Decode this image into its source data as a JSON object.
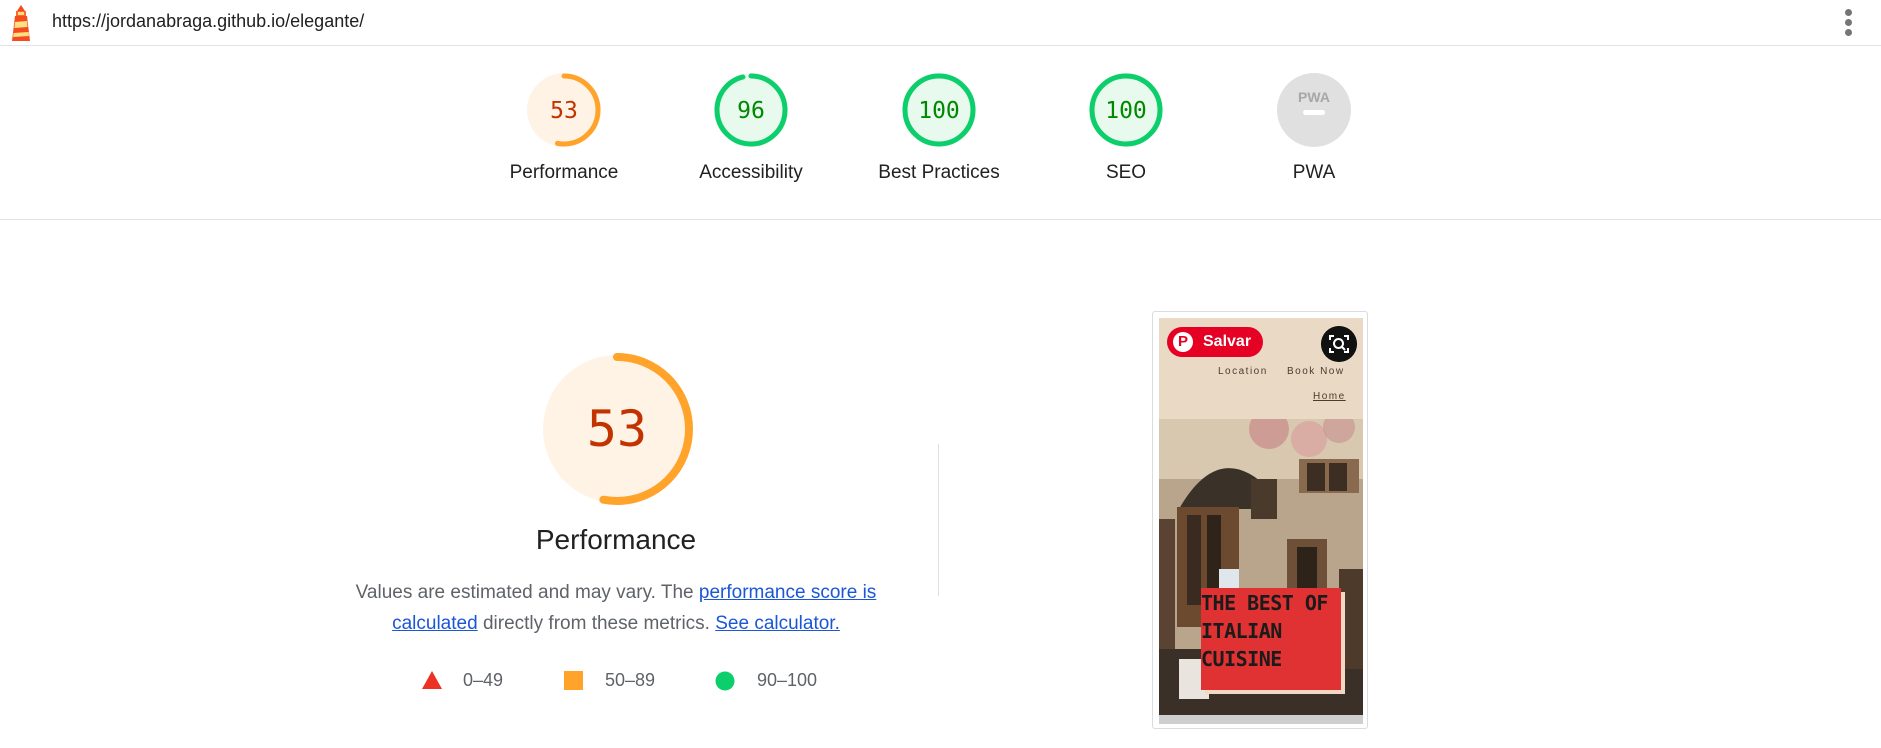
{
  "browser": {
    "url": "https://jordanabraga.github.io/elegante/",
    "logo_icon": "lighthouse-icon",
    "menu_icon": "more-vert-icon"
  },
  "colors": {
    "fail": "#eb3223",
    "average": "#ffa32b",
    "pass": "#0cce6b",
    "average_text": "#c33300",
    "pass_text": "#008800",
    "link": "#1a56d6"
  },
  "categories": [
    {
      "label": "Performance",
      "score": "53",
      "rating": "average",
      "value": 0.53
    },
    {
      "label": "Accessibility",
      "score": "96",
      "rating": "pass",
      "value": 0.96
    },
    {
      "label": "Best Practices",
      "score": "100",
      "rating": "pass",
      "value": 1.0
    },
    {
      "label": "SEO",
      "score": "100",
      "rating": "pass",
      "value": 1.0
    },
    {
      "label": "PWA",
      "score": "",
      "rating": "na",
      "badge": "PWA",
      "icon": "pwa-icon"
    }
  ],
  "performance": {
    "score": "53",
    "value": 0.53,
    "title": "Performance",
    "desc_prefix": "Values are estimated and may vary. The ",
    "desc_link": "performance score is calculated",
    "desc_middle": " directly from these metrics. ",
    "calc_link": "See calculator."
  },
  "legend": [
    {
      "range": "0–49",
      "icon": "triangle-fail-icon"
    },
    {
      "range": "50–89",
      "icon": "square-average-icon"
    },
    {
      "range": "90–100",
      "icon": "circle-pass-icon"
    }
  ],
  "screenshot": {
    "save_label": "Salvar",
    "pin_glyph": "P",
    "save_icon": "pinterest-icon",
    "lens_icon": "visual-search-icon",
    "nav_location": "Location",
    "nav_book": "Book Now",
    "nav_home": "Home",
    "hero_lines": [
      "THE BEST OF",
      "ITALIAN",
      "CUISINE"
    ]
  }
}
